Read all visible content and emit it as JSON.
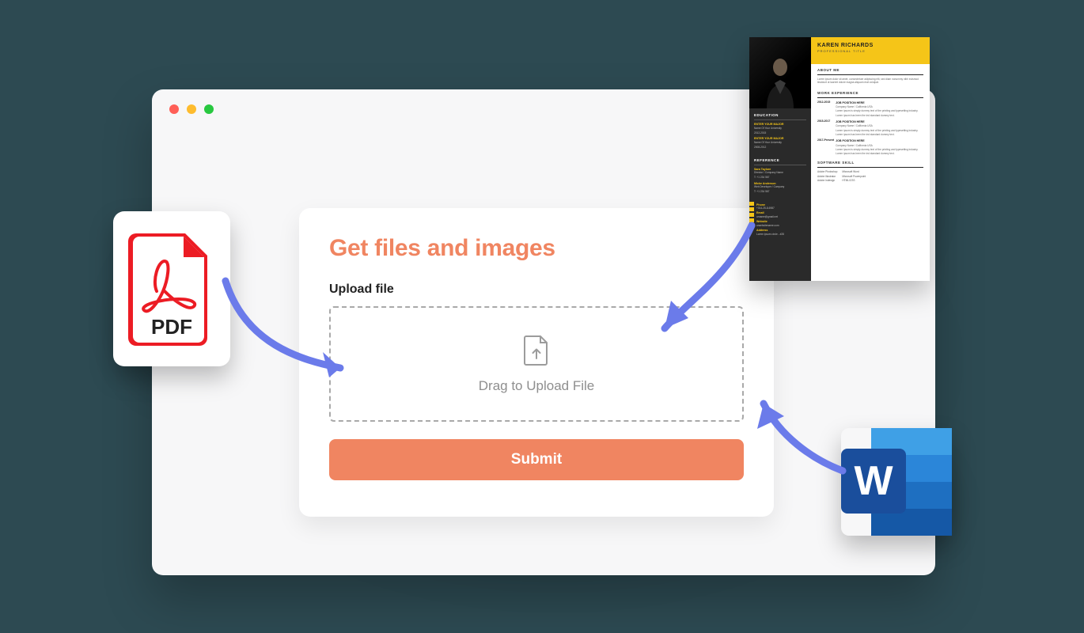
{
  "form": {
    "title": "Get files and images",
    "field_label": "Upload file",
    "dropzone_text": "Drag to Upload File",
    "submit_label": "Submit"
  },
  "icons": {
    "pdf_label": "PDF",
    "word_letter": "W"
  },
  "resume": {
    "name": "KAREN RICHARDS",
    "subtitle": "PROFESSIONAL TITLE",
    "side": {
      "education_heading": "EDUCATION",
      "edu1_title": "ENTER YOUR MAJOR",
      "edu1_sub": "Name Of Your University",
      "edu1_dates": "2012-2015",
      "edu2_title": "ENTER YOUR MAJOR",
      "edu2_sub": "Name Of Your University",
      "edu2_dates": "2008-2012",
      "reference_heading": "REFERENCE",
      "ref1_name": "Sara Taylore",
      "ref1_role": "Director / Company Name",
      "ref1_phone": "T: +1 234 567",
      "ref2_name": "Micke Anderson",
      "ref2_role": "Web Developer / Company",
      "ref2_phone": "T: +1 234 567",
      "phone_heading": "Phone",
      "phone_value": "+014-25-8-6987",
      "email_heading": "Email",
      "email_value": "urname@gmail.net",
      "website_heading": "Website",
      "website_value": "urwebsitename.com",
      "address_heading": "Address",
      "address_value": "Lorem ipsum circle - #28"
    },
    "main": {
      "about_heading": "ABOUT ME",
      "about_text": "Lorem ipsum dolor sit amet, consectetuer adipiscing elit, sed diam nonummy nibh euismod tincidunt ut laoreet dolore magna aliquam erat volutpat.",
      "work_heading": "WORK EXPERIENCE",
      "jobs": [
        {
          "date": "2012-2015",
          "role": "JOB POSITION HERE",
          "company": "Company Name / California USA",
          "text": "Lorem ipsum is simply dummy text of the printing and typesetting industry. Lorem ipsum has been the ind standard dummy text."
        },
        {
          "date": "2015-2017",
          "role": "JOB POSITION HERE",
          "company": "Company Name / California USA",
          "text": "Lorem ipsum is simply dummy text of the printing and typesetting industry. Lorem ipsum has been the ind standard dummy text."
        },
        {
          "date": "2017-Present",
          "role": "JOB POSITION HERE",
          "company": "Company Name / California USA",
          "text": "Lorem ipsum is simply dummy text of the printing and typesetting industry. Lorem ipsum has been the ind standard dummy text."
        }
      ],
      "skill_heading": "SOFTWARE SKILL",
      "skills_left": [
        "Adobe Photoshop",
        "Adobe Illustrator",
        "Adobe Indesign"
      ],
      "skills_right": [
        "Microsoft Word",
        "Microsoft Powerpoint",
        "HTML/CSS"
      ]
    }
  }
}
